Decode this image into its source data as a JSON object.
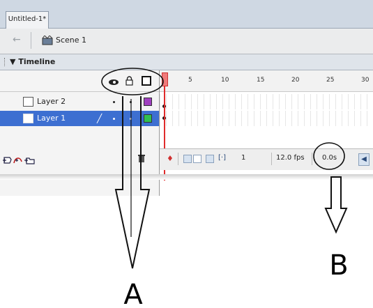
{
  "document": {
    "tab_title": "Untitled-1*"
  },
  "scene_bar": {
    "scene_label": "Scene 1"
  },
  "timeline": {
    "panel_title": "Timeline",
    "frame_numbers": [
      "5",
      "10",
      "15",
      "20",
      "25",
      "30"
    ],
    "layers": [
      {
        "name": "Layer 2",
        "color": "#a040c0",
        "selected": false
      },
      {
        "name": "Layer 1",
        "color": "#30c050",
        "selected": true
      }
    ],
    "status": {
      "current_frame": "1",
      "frame_rate": "12.0 fps",
      "elapsed_time": "0.0s"
    }
  },
  "annotations": {
    "label_a": "A",
    "label_b": "B"
  },
  "colors": {
    "selection": "#3d6fd1",
    "playhead": "#e02b2b",
    "tabstrip": "#cfd8e3"
  },
  "icons": [
    "back-arrow-icon",
    "scene-icon",
    "eye-icon",
    "lock-icon",
    "outline-icon",
    "pencil-icon",
    "add-layer-icon",
    "add-motion-guide-icon",
    "add-folder-icon",
    "trash-icon"
  ]
}
